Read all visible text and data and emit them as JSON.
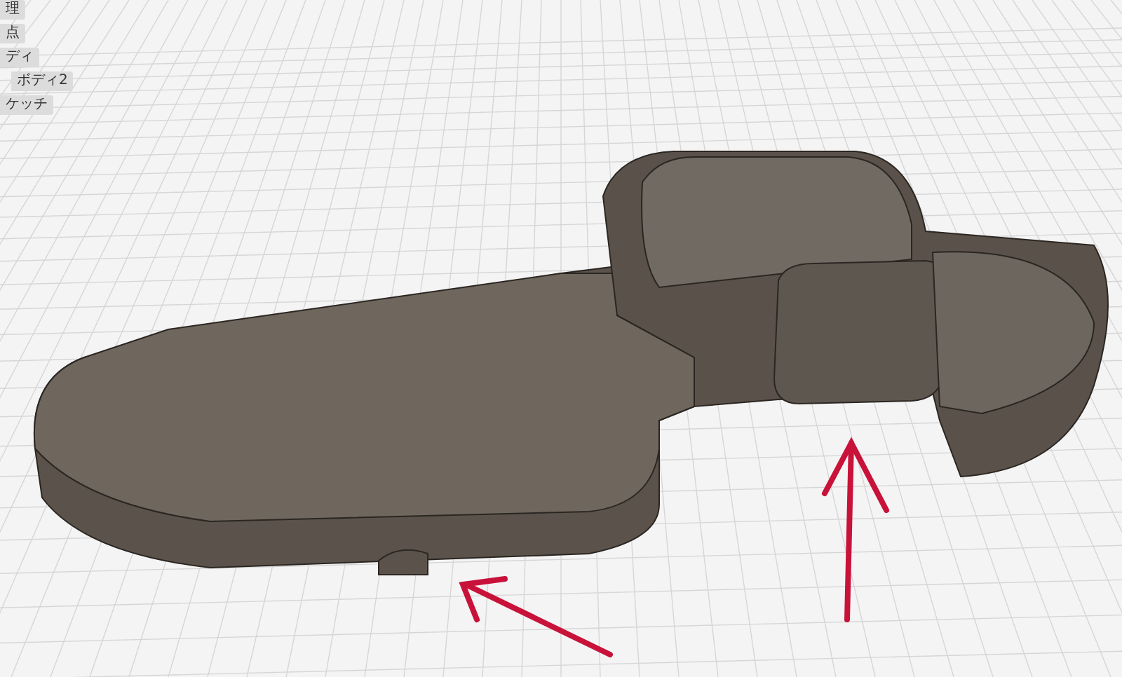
{
  "browser_tree": {
    "items": [
      {
        "label": "理"
      },
      {
        "label": "点"
      },
      {
        "label": "ディ",
        "children": [
          {
            "label": "ボディ2"
          }
        ]
      },
      {
        "label": "ケッチ"
      }
    ]
  }
}
